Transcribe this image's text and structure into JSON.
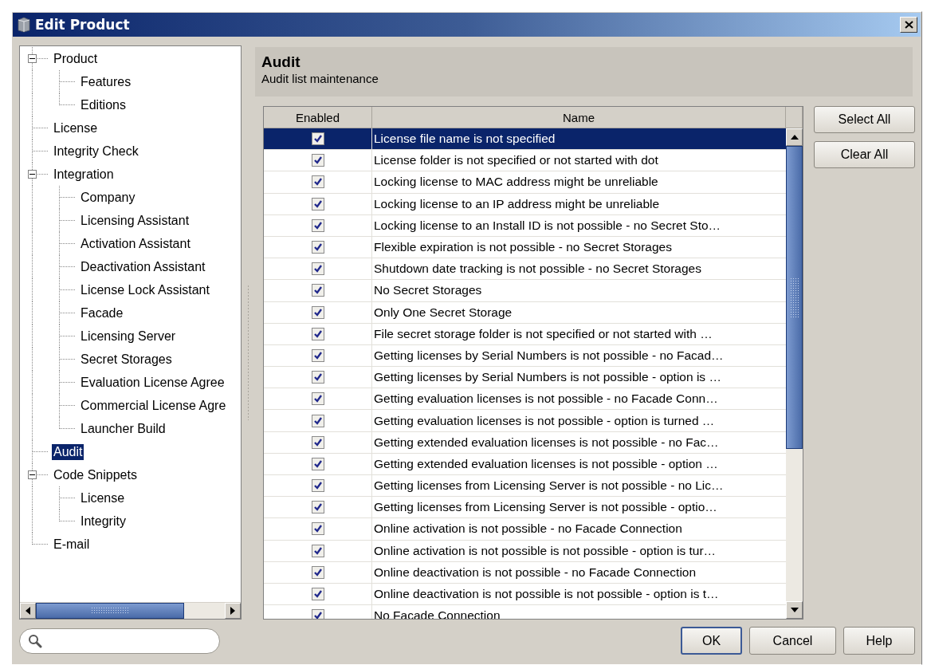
{
  "window": {
    "title": "Edit Product"
  },
  "tree": [
    {
      "label": "Product",
      "expanded": true,
      "selected": false,
      "children": [
        {
          "label": "Features",
          "selected": false
        },
        {
          "label": "Editions",
          "selected": false
        }
      ]
    },
    {
      "label": "License",
      "selected": false
    },
    {
      "label": "Integrity Check",
      "selected": false
    },
    {
      "label": "Integration",
      "expanded": true,
      "selected": false,
      "children": [
        {
          "label": "Company",
          "selected": false
        },
        {
          "label": "Licensing Assistant",
          "selected": false
        },
        {
          "label": "Activation Assistant",
          "selected": false
        },
        {
          "label": "Deactivation Assistant",
          "selected": false
        },
        {
          "label": "License Lock Assistant",
          "selected": false
        },
        {
          "label": "Facade",
          "selected": false
        },
        {
          "label": "Licensing Server",
          "selected": false
        },
        {
          "label": "Secret Storages",
          "selected": false
        },
        {
          "label": "Evaluation License Agree",
          "selected": false
        },
        {
          "label": "Commercial License Agre",
          "selected": false
        },
        {
          "label": "Launcher Build",
          "selected": false
        }
      ]
    },
    {
      "label": "Audit",
      "selected": true
    },
    {
      "label": "Code Snippets",
      "expanded": true,
      "selected": false,
      "children": [
        {
          "label": "License",
          "selected": false
        },
        {
          "label": "Integrity",
          "selected": false
        }
      ]
    },
    {
      "label": "E-mail",
      "selected": false
    }
  ],
  "panel": {
    "title": "Audit",
    "subtitle": "Audit list maintenance"
  },
  "table": {
    "columns": [
      "Enabled",
      "Name"
    ],
    "rows": [
      {
        "enabled": true,
        "name": "License file name is not specified",
        "selected": true
      },
      {
        "enabled": true,
        "name": "License folder is not specified or not started with dot",
        "selected": false
      },
      {
        "enabled": true,
        "name": "Locking license to MAC address might be unreliable",
        "selected": false
      },
      {
        "enabled": true,
        "name": "Locking license to an IP address might be unreliable",
        "selected": false
      },
      {
        "enabled": true,
        "name": "Locking license to an Install ID is not possible - no Secret Sto…",
        "selected": false
      },
      {
        "enabled": true,
        "name": "Flexible expiration is not possible - no Secret Storages",
        "selected": false
      },
      {
        "enabled": true,
        "name": "Shutdown date tracking is not possible - no Secret Storages",
        "selected": false
      },
      {
        "enabled": true,
        "name": "No Secret Storages",
        "selected": false
      },
      {
        "enabled": true,
        "name": "Only One Secret Storage",
        "selected": false
      },
      {
        "enabled": true,
        "name": "File secret storage folder is not specified or not started with …",
        "selected": false
      },
      {
        "enabled": true,
        "name": "Getting licenses by Serial Numbers is not possible - no Facad…",
        "selected": false
      },
      {
        "enabled": true,
        "name": "Getting licenses by Serial Numbers is not possible - option is …",
        "selected": false
      },
      {
        "enabled": true,
        "name": "Getting evaluation licenses is not possible - no Facade Conn…",
        "selected": false
      },
      {
        "enabled": true,
        "name": "Getting evaluation licenses is not possible - option is turned …",
        "selected": false
      },
      {
        "enabled": true,
        "name": "Getting extended evaluation licenses is not possible - no Fac…",
        "selected": false
      },
      {
        "enabled": true,
        "name": "Getting extended evaluation licenses is not possible - option …",
        "selected": false
      },
      {
        "enabled": true,
        "name": "Getting licenses from Licensing Server is not possible - no Lic…",
        "selected": false
      },
      {
        "enabled": true,
        "name": "Getting licenses from Licensing Server is not possible - optio…",
        "selected": false
      },
      {
        "enabled": true,
        "name": "Online activation is not possible - no Facade Connection",
        "selected": false
      },
      {
        "enabled": true,
        "name": "Online activation is not possible is not possible - option is tur…",
        "selected": false
      },
      {
        "enabled": true,
        "name": "Online deactivation is not possible - no Facade Connection",
        "selected": false
      },
      {
        "enabled": true,
        "name": "Online deactivation is not possible is not possible - option is t…",
        "selected": false
      },
      {
        "enabled": true,
        "name": "No Facade Connection",
        "selected": false
      }
    ]
  },
  "side_buttons": [
    "Select All",
    "Clear All"
  ],
  "buttons": [
    {
      "label": "OK",
      "default": true
    },
    {
      "label": "Cancel",
      "default": false
    },
    {
      "label": "Help",
      "default": false
    }
  ]
}
